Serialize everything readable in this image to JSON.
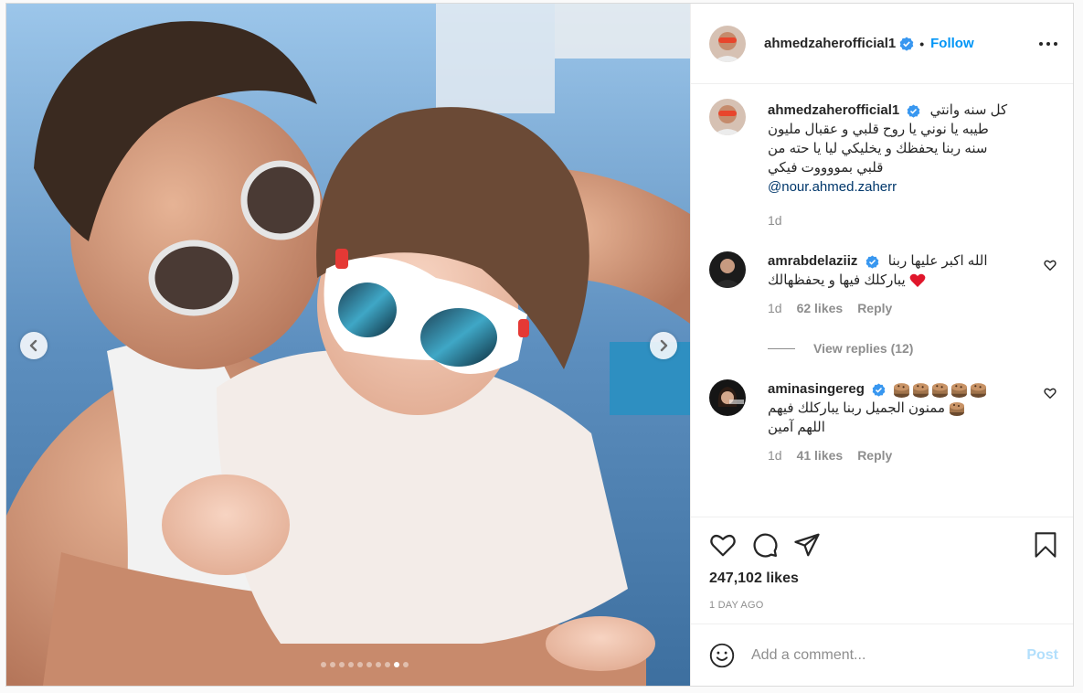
{
  "post": {
    "author": "ahmedzaherofficial1",
    "follow_label": "Follow",
    "separator": "•"
  },
  "caption": {
    "author": "ahmedzaherofficial1",
    "lines": [
      "كل سنه وانتي",
      "طيبه يا نوني يا روح قلبي و عقبال مليون",
      "سنه ربنا يحفظك و يخليكي ليا يا حته من",
      "قلبي بمووووت فيكي"
    ],
    "mention": "@nour.ahmed.zaherr",
    "time": "1d"
  },
  "comments": [
    {
      "author": "amrabdelaziiz",
      "line1": "الله اكبر عليها ربنا",
      "line2": "يباركلك فيها و يحفظهالك",
      "time": "1d",
      "likes": "62 likes",
      "reply_label": "Reply",
      "view_replies": "View replies (12)"
    },
    {
      "author": "aminasingereg",
      "line1": "ممنون الجميل ربنا يباركلك فيهم",
      "line2": "اللهم آمين",
      "time": "1d",
      "likes": "41 likes",
      "reply_label": "Reply"
    }
  ],
  "stats": {
    "likes": "247,102 likes",
    "date": "1 DAY AGO"
  },
  "composer": {
    "placeholder": "Add a comment...",
    "post_label": "Post"
  },
  "carousel": {
    "slide_count": 10,
    "active_index": 8
  },
  "colors": {
    "accent": "#0095f6",
    "verified": "#3897f0",
    "post_disabled": "#b2dffc",
    "mention": "#00376b",
    "muted": "#8e8e8e"
  },
  "icons": [
    "verified-badge-icon",
    "more-options-icon",
    "heart-icon",
    "comment-icon",
    "share-icon",
    "bookmark-icon",
    "emoji-icon",
    "chevron-left-icon",
    "chevron-right-icon",
    "red-heart-emoji",
    "cake-emoji"
  ]
}
